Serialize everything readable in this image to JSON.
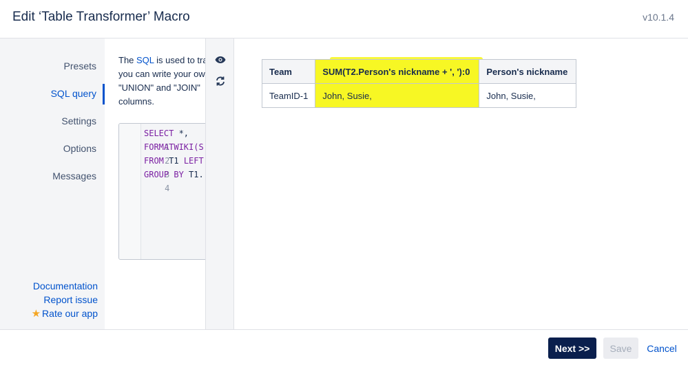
{
  "header": {
    "title": "Edit ‘Table Transformer’ Macro",
    "version": "v10.1.4"
  },
  "sidebar": {
    "items": [
      {
        "label": "Presets"
      },
      {
        "label": "SQL query"
      },
      {
        "label": "Settings"
      },
      {
        "label": "Options"
      },
      {
        "label": "Messages"
      }
    ],
    "active_index": 1,
    "links": {
      "documentation": "Documentation",
      "report": "Report issue",
      "rate": "Rate our app"
    }
  },
  "editor": {
    "desc_line1_pre": "The ",
    "desc_line1_link": "SQL",
    "desc_line1_post": " is used to tra",
    "desc_line2": "you can write your ow",
    "desc_line3": "\"UNION\" and \"JOIN\"",
    "desc_line4": "columns.",
    "lines": [
      {
        "num": "1",
        "kw": "SELECT",
        "rest": " *,"
      },
      {
        "num": "2",
        "kw": "FORMATWIKI(",
        "rest": "S"
      },
      {
        "num": "3",
        "kw": "FROM",
        "rest": " T1 ",
        "kw2": "LEFT"
      },
      {
        "num": "4",
        "kw": "GROUP BY",
        "rest": " T1."
      }
    ]
  },
  "table": {
    "headers": [
      "Team",
      "SUM(T2.Person's nickname + ', '):0",
      "Person's nickname"
    ],
    "rows": [
      [
        "TeamID-1",
        "John, Susie,",
        "John, Susie,"
      ]
    ]
  },
  "colors": {
    "highlight": "#f7f724",
    "primary": "#0a1f4d",
    "link": "#0052cc"
  },
  "footer": {
    "next": "Next >>",
    "save": "Save",
    "cancel": "Cancel"
  }
}
